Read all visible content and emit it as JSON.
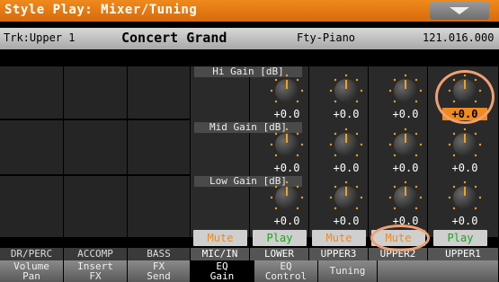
{
  "header": {
    "title": "Style Play: Mixer/Tuning",
    "menu_icon": "chevron-down-icon"
  },
  "info": {
    "track": "Trk:Upper 1",
    "sound": "Concert Grand",
    "bank": "Fty-Piano",
    "number": "121.016.000"
  },
  "sections": {
    "hi": "Hi Gain [dB]",
    "mid": "Mid Gain [dB]",
    "low": "Low Gain [dB]"
  },
  "eq_values": {
    "mic_in": {
      "hi": "",
      "mid": "",
      "low": ""
    },
    "lower": {
      "hi": "+0.0",
      "mid": "+0.0",
      "low": "+0.0"
    },
    "upper3": {
      "hi": "+0.0",
      "mid": "+0.0",
      "low": "+0.0"
    },
    "upper2": {
      "hi": "+0.0",
      "mid": "+0.0",
      "low": "+0.0"
    },
    "upper1": {
      "hi": "+0.0",
      "mid": "+0.0",
      "low": "+0.0"
    }
  },
  "mute_buttons": [
    "Mute",
    "Play",
    "Mute",
    "Mute",
    "Play"
  ],
  "channels": [
    "DR/PERC",
    "ACCOMP",
    "BASS",
    "MIC/IN",
    "LOWER",
    "UPPER3",
    "UPPER2",
    "UPPER1"
  ],
  "tabs": [
    {
      "line1": "Volume",
      "line2": "Pan"
    },
    {
      "line1": "Insert",
      "line2": "FX"
    },
    {
      "line1": "FX",
      "line2": "Send"
    },
    {
      "line1": "EQ",
      "line2": "Gain"
    },
    {
      "line1": "EQ",
      "line2": "Control"
    },
    {
      "line1": "Tuning",
      "line2": ""
    }
  ],
  "colors": {
    "accent": "#f08a1c",
    "play": "#1aa61a",
    "highlight_ring": "#f0a070"
  }
}
